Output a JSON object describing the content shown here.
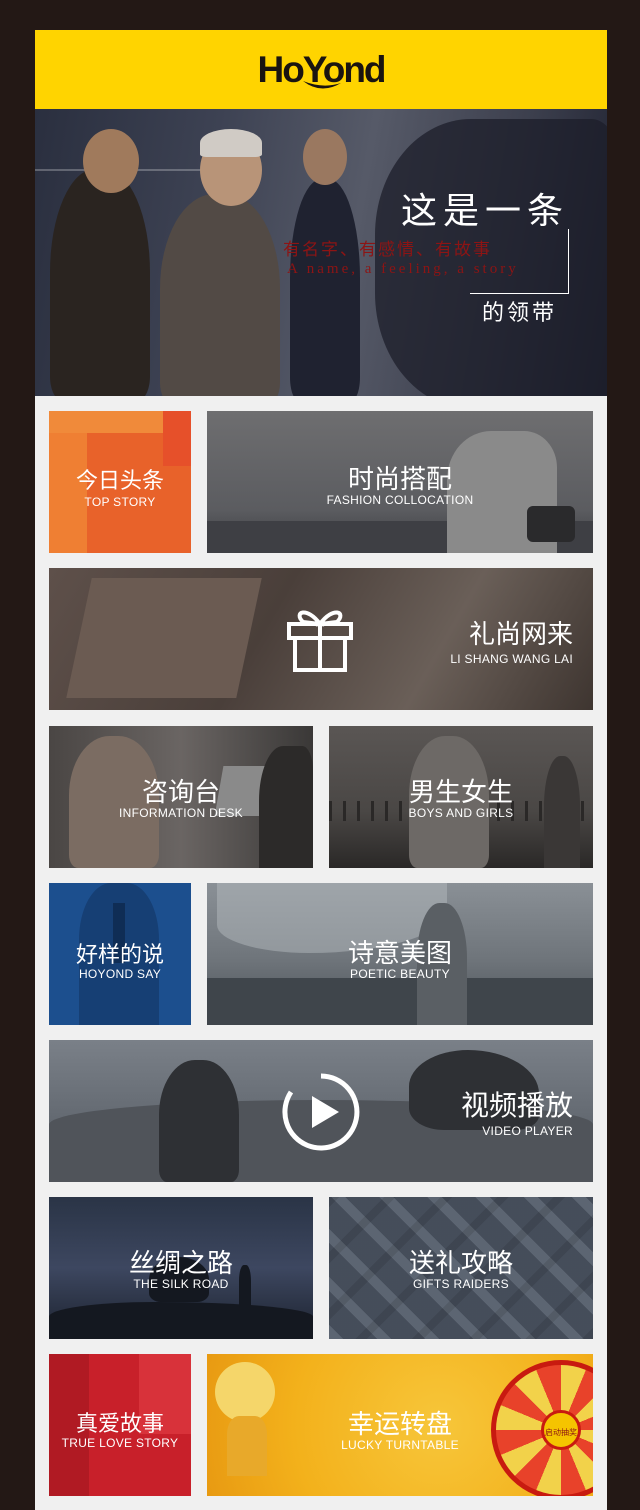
{
  "header": {
    "logo": "HoYond"
  },
  "hero": {
    "title": "这是一条",
    "subtitle_cn": "有名字、有感情、有故事",
    "subtitle_en": "A name, a feeling, a story",
    "tail": "的领带"
  },
  "tiles": {
    "top_story": {
      "cn": "今日头条",
      "en": "TOP STORY"
    },
    "fashion": {
      "cn": "时尚搭配",
      "en": "FASHION COLLOCATION"
    },
    "gifts_shop": {
      "cn": "礼尚网来",
      "en": "LI SHANG WANG LAI",
      "icon": "gift-icon"
    },
    "info_desk": {
      "cn": "咨询台",
      "en": "INFORMATION DESK"
    },
    "boys_girls": {
      "cn": "男生女生",
      "en": "BOYS AND GIRLS"
    },
    "hoyond_say": {
      "cn": "好样的说",
      "en": "HOYOND SAY"
    },
    "poetic": {
      "cn": "诗意美图",
      "en": "POETIC BEAUTY"
    },
    "video": {
      "cn": "视频播放",
      "en": "VIDEO PLAYER",
      "icon": "play-icon"
    },
    "silk_road": {
      "cn": "丝绸之路",
      "en": "THE SILK ROAD"
    },
    "gifts_raiders": {
      "cn": "送礼攻略",
      "en": "GIFTS RAIDERS"
    },
    "true_love": {
      "cn": "真爱故事",
      "en": "TRUE LOVE STORY"
    },
    "lucky": {
      "cn": "幸运转盘",
      "en": "LUCKY TURNTABLE",
      "wheel_button": "启动抽奖"
    }
  },
  "colors": {
    "header_yellow": "#ffd400",
    "top_story_orange": "#e8622a",
    "true_love_red": "#c8202a",
    "lucky_yellow": "#f3b11b",
    "hoyond_say_blue": "#1c4f8e",
    "dark_gray": "#5b5c60"
  }
}
